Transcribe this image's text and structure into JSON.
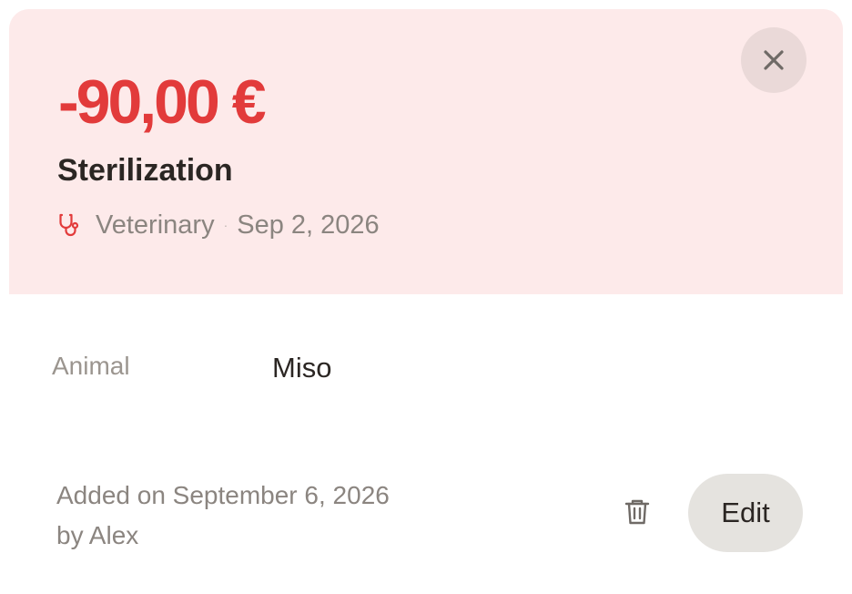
{
  "expense": {
    "amount": "-90,00 €",
    "title": "Sterilization",
    "category": "Veterinary",
    "date": "Sep 2, 2026",
    "category_icon": "stethoscope-icon",
    "separator": "·"
  },
  "details": {
    "animal_label": "Animal",
    "animal_value": "Miso"
  },
  "footer": {
    "added_on": "Added on September 6, 2026",
    "added_by": "by Alex",
    "edit_label": "Edit",
    "delete_icon": "trash-icon",
    "close_icon": "close-icon"
  },
  "colors": {
    "amount": "#e23b3b",
    "header_background": "#fdeaea",
    "edit_button": "#e5e3df"
  }
}
